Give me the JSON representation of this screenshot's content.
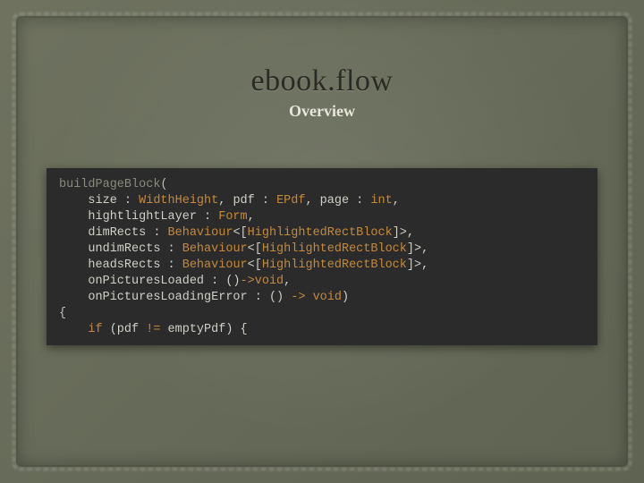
{
  "title": "ebook.flow",
  "subtitle": "Overview",
  "code": {
    "fn": "buildPageBlock",
    "params": [
      "size : WidthHeight, pdf : EPdf, page : int,",
      "hightlightLayer : Form,",
      "dimRects : Behaviour<[HighlightedRectBlock]>,",
      "undimRects : Behaviour<[HighlightedRectBlock]>,",
      "headsRects : Behaviour<[HighlightedRectBlock]>,",
      "onPicturesLoaded : ()->void,",
      "onPicturesLoadingError : () -> void)"
    ],
    "body_open": "{",
    "body_line": "if (pdf != emptyPdf) {"
  }
}
